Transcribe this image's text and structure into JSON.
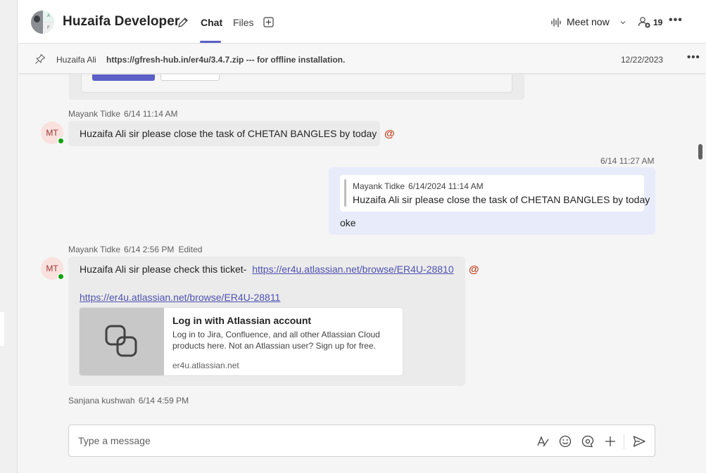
{
  "header": {
    "group_avatar_initials": [
      "A",
      "F"
    ],
    "title": "Huzaifa Developer",
    "tabs": [
      {
        "label": "Chat",
        "active": true
      },
      {
        "label": "Files",
        "active": false
      }
    ],
    "meet_now_label": "Meet now",
    "participants_count": "19",
    "accent_color": "#5b5fc7"
  },
  "pinned": {
    "author": "Huzaifa Ali",
    "text": "https://gfresh-hub.in/er4u/3.4.7.zip --- for offline installation.",
    "date": "12/22/2023"
  },
  "messages": [
    {
      "author": "Mayank Tidke",
      "time": "6/14 11:14 AM",
      "initials": "MT",
      "mention": "Huzaifa Ali",
      "text": "sir please close the task of CHETAN BANGLES by today"
    },
    {
      "self": true,
      "time": "6/14 11:27 AM",
      "quote_author": "Mayank Tidke",
      "quote_time": "6/14/2024 11:14 AM",
      "quote_text": "Huzaifa Ali sir please close the task of CHETAN BANGLES by today",
      "text": "oke"
    },
    {
      "author": "Mayank Tidke",
      "time": "6/14 2:56 PM",
      "edited": "Edited",
      "initials": "MT",
      "mention": "Huzaifa Ali",
      "text": "sir please check this ticket-",
      "link1": "https://er4u.atlassian.net/browse/ER4U-28810",
      "link2": "https://er4u.atlassian.net/browse/ER4U-28811",
      "preview": {
        "title": "Log in with Atlassian account",
        "description": "Log in to Jira, Confluence, and all other Atlassian Cloud products here. Not an Atlassian user? Sign up for free.",
        "domain": "er4u.atlassian.net"
      }
    },
    {
      "author": "Sanjana kushwah",
      "time": "6/14 4:59 PM"
    }
  ],
  "composer": {
    "placeholder": "Type a message"
  },
  "icons": {
    "edit": "pencil-icon",
    "add_tab": "add-tab-icon",
    "meet": "meet-audio-icon",
    "participants": "people-add-icon",
    "pin": "pin-icon",
    "format": "format-icon",
    "emoji": "emoji-icon",
    "loop": "loop-icon",
    "attach": "plus-icon",
    "send": "send-icon"
  }
}
